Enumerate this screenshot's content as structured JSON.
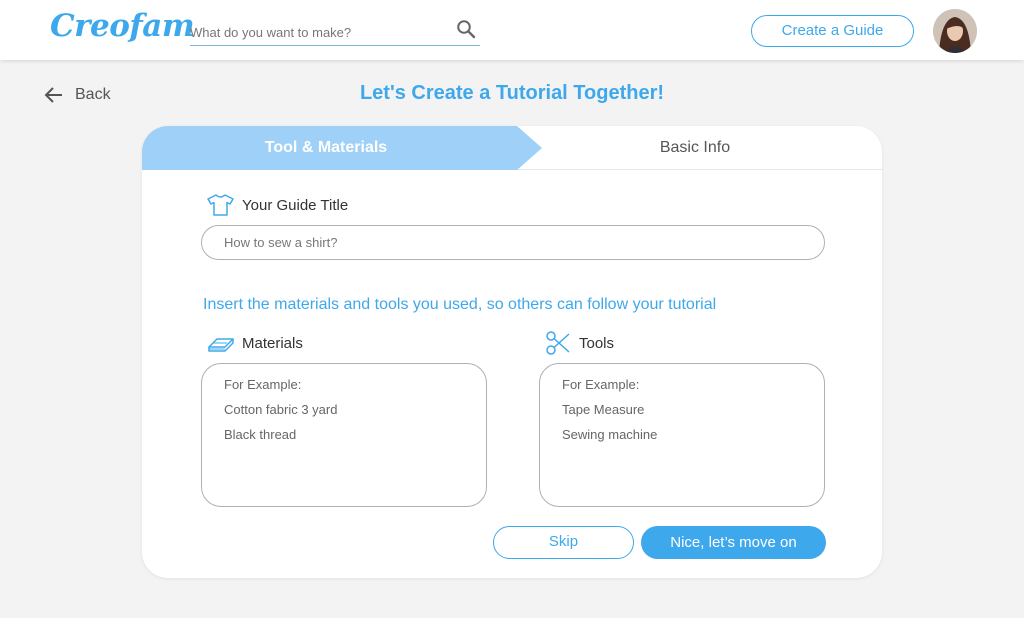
{
  "app": {
    "logo": "Creofam"
  },
  "header": {
    "search_placeholder": "What do you want to make?",
    "create_label": "Create a Guide"
  },
  "nav": {
    "back_label": "Back"
  },
  "page": {
    "title": "Let's Create a Tutorial Together!"
  },
  "steps": {
    "active": "Tool & Materials",
    "next": "Basic Info"
  },
  "form": {
    "title_label": "Your Guide Title",
    "title_placeholder": "How to sew a shirt?",
    "instruction": "Insert the materials and tools you used, so others can follow your tutorial",
    "materials": {
      "label": "Materials",
      "lines": [
        "For Example:",
        "Cotton fabric 3 yard",
        "Black thread"
      ]
    },
    "tools": {
      "label": "Tools",
      "lines": [
        "For Example:",
        "Tape Measure",
        "Sewing machine"
      ]
    }
  },
  "actions": {
    "skip_label": "Skip",
    "next_label": "Nice, let’s move on"
  },
  "colors": {
    "accent": "#3ea8ec",
    "step_active": "#9fd0f7",
    "background": "#f3f3f3"
  },
  "icons": {
    "search": "search-icon",
    "back": "arrow-left-icon",
    "title": "tshirt-icon",
    "materials": "fabric-stack-icon",
    "tools": "scissors-icon"
  }
}
